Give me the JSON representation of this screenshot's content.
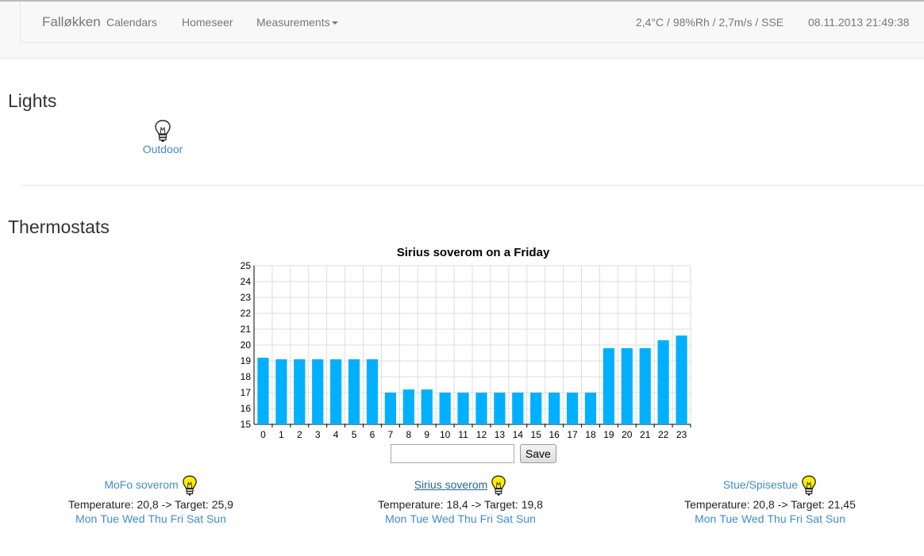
{
  "navbar": {
    "brand": "Falløkken",
    "links": [
      "Calendars",
      "Homeseer"
    ],
    "dropdown": "Measurements",
    "weather": "2,4°C / 98%Rh / 2,7m/s / SSE",
    "datetime": "08.11.2013 21:49:38"
  },
  "lights": {
    "heading": "Lights",
    "items": [
      {
        "label": "Outdoor",
        "icon": "lightbulb-off-icon"
      }
    ]
  },
  "thermostats": {
    "heading": "Thermostats",
    "save_label": "Save",
    "input_value": "",
    "items": [
      {
        "name": "MoFo soverom",
        "icon": "lightbulb-on-icon",
        "temperature": "Temperature: 20,8 -> Target: 25,9"
      },
      {
        "name": "Sirius soverom",
        "icon": "lightbulb-on-icon",
        "temperature": "Temperature: 18,4 -> Target: 19,8",
        "selected": true
      },
      {
        "name": "Stue/Spisestue",
        "icon": "lightbulb-on-icon",
        "temperature": "Temperature: 20,8 -> Target: 21,45"
      }
    ],
    "days": [
      "Mon",
      "Tue",
      "Wed",
      "Thu",
      "Fri",
      "Sat",
      "Sun"
    ]
  },
  "colors": {
    "bar": "#00b0ff",
    "link": "#428bca",
    "bulb_on": "#ffee00"
  },
  "chart_data": {
    "type": "bar",
    "title": "Sirius soverom on a Friday",
    "categories": [
      "0",
      "1",
      "2",
      "3",
      "4",
      "5",
      "6",
      "7",
      "8",
      "9",
      "10",
      "11",
      "12",
      "13",
      "14",
      "15",
      "16",
      "17",
      "18",
      "19",
      "20",
      "21",
      "22",
      "23"
    ],
    "values": [
      19.2,
      19.1,
      19.1,
      19.1,
      19.1,
      19.1,
      19.1,
      17.0,
      17.2,
      17.2,
      17.0,
      17.0,
      17.0,
      17.0,
      17.0,
      17.0,
      17.0,
      17.0,
      17.0,
      19.8,
      19.8,
      19.8,
      20.3,
      20.6
    ],
    "ylim": [
      15,
      25
    ],
    "yticks": [
      15,
      16,
      17,
      18,
      19,
      20,
      21,
      22,
      23,
      24,
      25
    ],
    "grid": true,
    "xlabel": "",
    "ylabel": ""
  }
}
